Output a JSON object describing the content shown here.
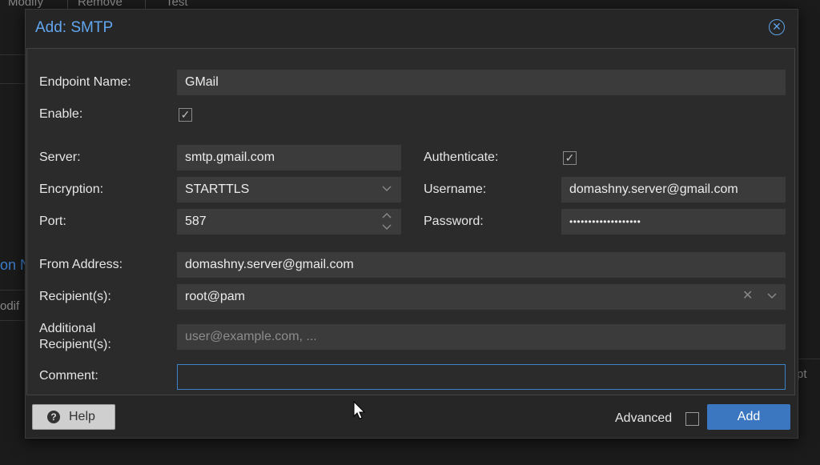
{
  "background": {
    "toolbar": [
      "Modify",
      "Remove",
      "Test"
    ],
    "left_fragment_1": "on N",
    "left_fragment_2": "odif",
    "right_fragment": "pt"
  },
  "dialog": {
    "title": "Add: SMTP",
    "close_icon": "circle-x-icon",
    "fields": {
      "endpoint_name": {
        "label": "Endpoint Name:",
        "value": "GMail"
      },
      "enable": {
        "label": "Enable:",
        "checked": true
      },
      "server": {
        "label": "Server:",
        "value": "smtp.gmail.com"
      },
      "encryption": {
        "label": "Encryption:",
        "value": "STARTTLS"
      },
      "port": {
        "label": "Port:",
        "value": "587"
      },
      "authenticate": {
        "label": "Authenticate:",
        "checked": true
      },
      "username": {
        "label": "Username:",
        "value": "domashny.server@gmail.com"
      },
      "password": {
        "label": "Password:",
        "value": "•••••••••••••••••••"
      },
      "from_address": {
        "label": "From Address:",
        "value": "domashny.server@gmail.com"
      },
      "recipients": {
        "label": "Recipient(s):",
        "value": "root@pam"
      },
      "additional_recipients": {
        "label_line1": "Additional",
        "label_line2": "Recipient(s):",
        "placeholder": "user@example.com, ..."
      },
      "comment": {
        "label": "Comment:",
        "value": ""
      }
    },
    "footer": {
      "help_label": "Help",
      "help_icon": "?",
      "advanced_label": "Advanced",
      "advanced_checked": false,
      "add_label": "Add"
    }
  },
  "colors": {
    "accent": "#3a77c0",
    "title": "#63a7f0",
    "dialog_bg": "#262626",
    "field_bg": "#3b3b3b"
  }
}
